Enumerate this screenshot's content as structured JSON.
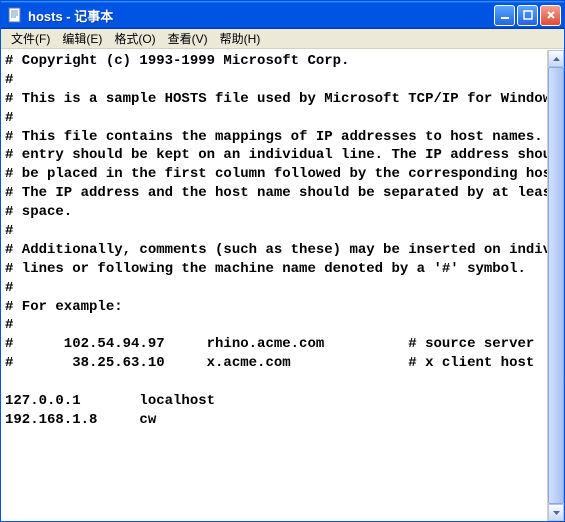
{
  "titlebar": {
    "title": "hosts - 记事本"
  },
  "menubar": {
    "file": "文件(F)",
    "edit": "编辑(E)",
    "format": "格式(O)",
    "view": "查看(V)",
    "help": "帮助(H)"
  },
  "content": "# Copyright (c) 1993-1999 Microsoft Corp.\n#\n# This is a sample HOSTS file used by Microsoft TCP/IP for Windows.\n#\n# This file contains the mappings of IP addresses to host names. Each\n# entry should be kept on an individual line. The IP address should\n# be placed in the first column followed by the corresponding host name.\n# The IP address and the host name should be separated by at least one\n# space.\n#\n# Additionally, comments (such as these) may be inserted on individual\n# lines or following the machine name denoted by a '#' symbol.\n#\n# For example:\n#\n#      102.54.94.97     rhino.acme.com          # source server\n#       38.25.63.10     x.acme.com              # x client host\n\n127.0.0.1       localhost\n192.168.1.8     cw"
}
